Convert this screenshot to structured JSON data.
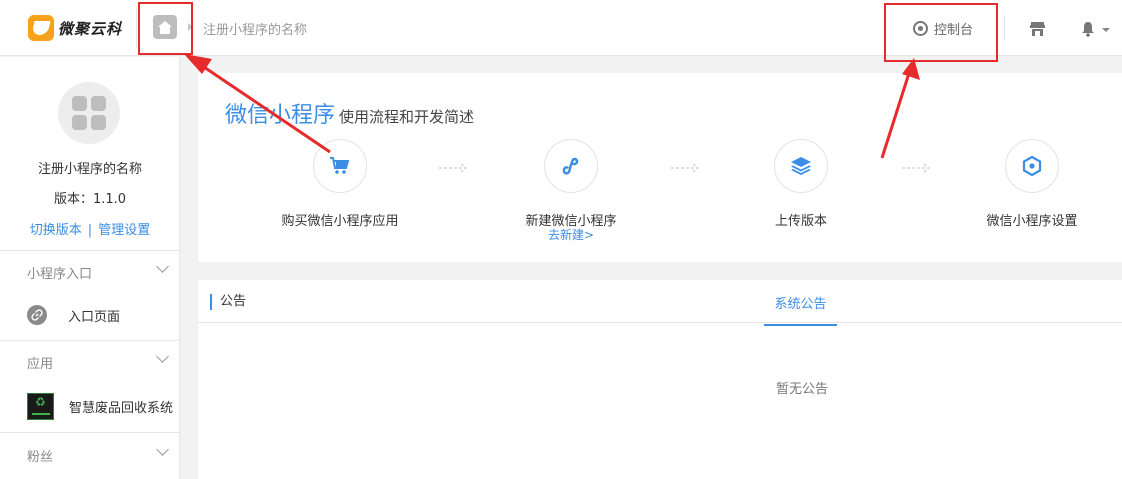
{
  "header": {
    "logo_text": "微聚云科",
    "breadcrumb": "注册小程序的名称",
    "console_label": "控制台",
    "icons": {
      "home": "home-icon",
      "console": "dashboard-icon",
      "shop": "store-icon",
      "bell": "bell-icon"
    }
  },
  "sidebar": {
    "app_name": "注册小程序的名称",
    "version": "版本：1.1.0",
    "switch_version": "切换版本",
    "divider": "|",
    "manage_settings": "管理设置",
    "sections": [
      {
        "title": "小程序入口",
        "items": [
          {
            "label": "入口页面",
            "icon": "link-icon"
          }
        ]
      },
      {
        "title": "应用",
        "items": [
          {
            "label": "智慧废品回收系统",
            "icon": "recycle-app-icon"
          }
        ]
      },
      {
        "title": "粉丝",
        "items": []
      }
    ]
  },
  "flow": {
    "title_main": "微信小程序",
    "title_sub": "使用流程和开发简述",
    "steps": [
      {
        "label": "购买微信小程序应用",
        "icon": "cart-icon"
      },
      {
        "label": "新建微信小程序",
        "sub": "去新建>",
        "icon": "miniprogram-icon"
      },
      {
        "label": "上传版本",
        "icon": "layers-icon"
      },
      {
        "label": "微信小程序设置",
        "icon": "hexagon-settings-icon"
      }
    ]
  },
  "notice": {
    "title": "公告",
    "tab": "系统公告",
    "empty": "暂无公告"
  },
  "colors": {
    "accent": "#3a8ee6",
    "annotation": "#e52b2b",
    "logo": "#f7a21b"
  }
}
